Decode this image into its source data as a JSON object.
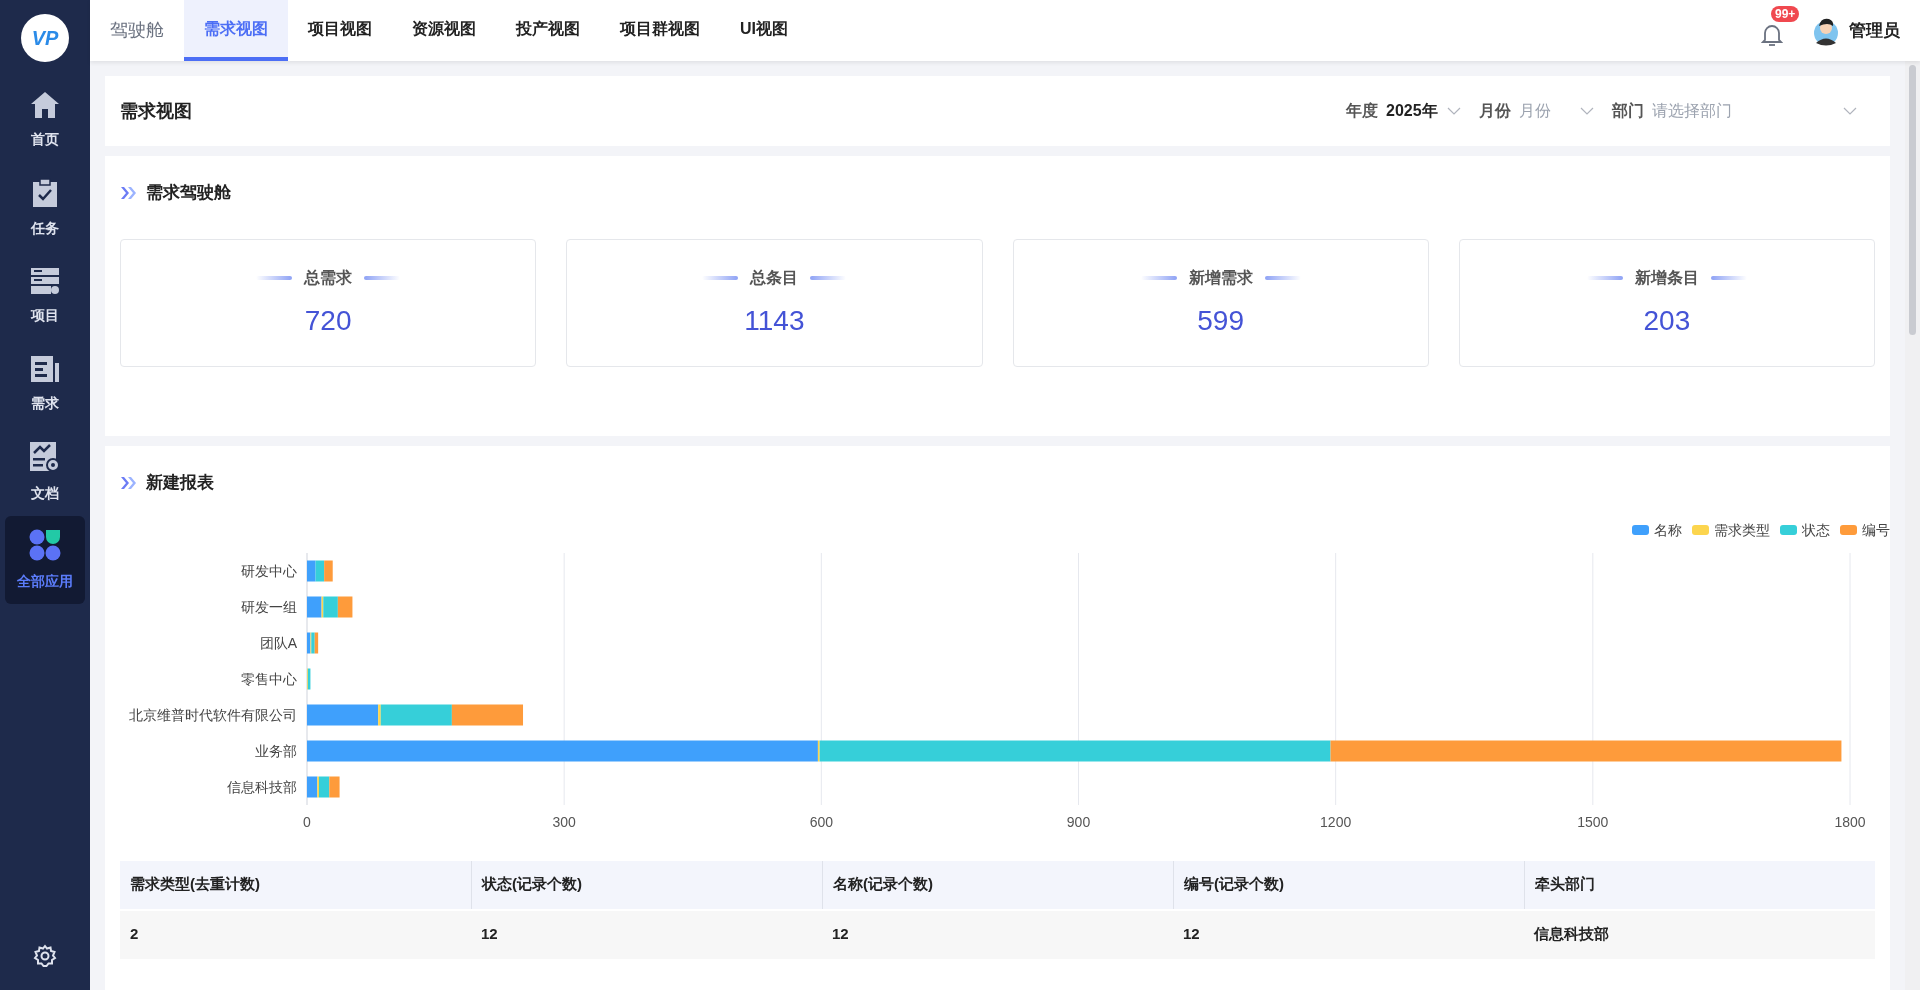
{
  "sidebar": {
    "logo_text": "VP",
    "items": [
      {
        "label": "首页",
        "selected": false
      },
      {
        "label": "任务",
        "selected": false
      },
      {
        "label": "项目",
        "selected": false
      },
      {
        "label": "需求",
        "selected": false
      },
      {
        "label": "文档",
        "selected": false
      },
      {
        "label": "全部应用",
        "selected": true
      }
    ]
  },
  "top_nav": {
    "title": "驾驶舱",
    "tabs": [
      {
        "label": "需求视图",
        "selected": true
      },
      {
        "label": "项目视图",
        "selected": false
      },
      {
        "label": "资源视图",
        "selected": false
      },
      {
        "label": "投产视图",
        "selected": false
      },
      {
        "label": "项目群视图",
        "selected": false
      },
      {
        "label": "UI视图",
        "selected": false
      }
    ],
    "notification_badge": "99+",
    "user_name": "管理员"
  },
  "page_header": {
    "title": "需求视图",
    "filters": [
      {
        "label": "年度",
        "value": "2025年"
      },
      {
        "label": "月份",
        "placeholder": "月份"
      },
      {
        "label": "部门",
        "placeholder": "请选择部门"
      }
    ]
  },
  "kpi_section": {
    "title": "需求驾驶舱",
    "cards": [
      {
        "label": "总需求",
        "value": "720"
      },
      {
        "label": "总条目",
        "value": "1143"
      },
      {
        "label": "新增需求",
        "value": "599"
      },
      {
        "label": "新增条目",
        "value": "203"
      }
    ]
  },
  "report_section": {
    "title": "新建报表",
    "chart_data": {
      "type": "bar",
      "orientation": "horizontal",
      "stacked": true,
      "categories": [
        "研发中心",
        "研发一组",
        "团队A",
        "零售中心",
        "北京维普时代软件有限公司",
        "业务部",
        "信息科技部"
      ],
      "series": [
        {
          "name": "名称",
          "color": "#3fa0fc",
          "values": [
            10,
            17,
            4,
            0,
            83,
            596,
            12
          ]
        },
        {
          "name": "需求类型",
          "color": "#fcd54e",
          "values": [
            null,
            2,
            1,
            1,
            3,
            2,
            2
          ]
        },
        {
          "name": "状态",
          "color": "#36cfd9",
          "values": [
            10,
            17,
            4,
            3,
            83,
            596,
            12
          ]
        },
        {
          "name": "编号",
          "color": "#fe9b3b",
          "values": [
            10,
            17,
            4,
            0,
            83,
            596,
            12
          ]
        }
      ],
      "grid": true,
      "xlim": [
        0,
        1800
      ],
      "xticks": [
        0,
        300,
        600,
        900,
        1200,
        1500,
        1800
      ]
    },
    "table": {
      "columns": [
        "需求类型(去重计数)",
        "状态(记录个数)",
        "名称(记录个数)",
        "编号(记录个数)",
        "牵头部门"
      ],
      "rows": [
        [
          "2",
          "12",
          "12",
          "12",
          "信息科技部"
        ]
      ]
    }
  }
}
